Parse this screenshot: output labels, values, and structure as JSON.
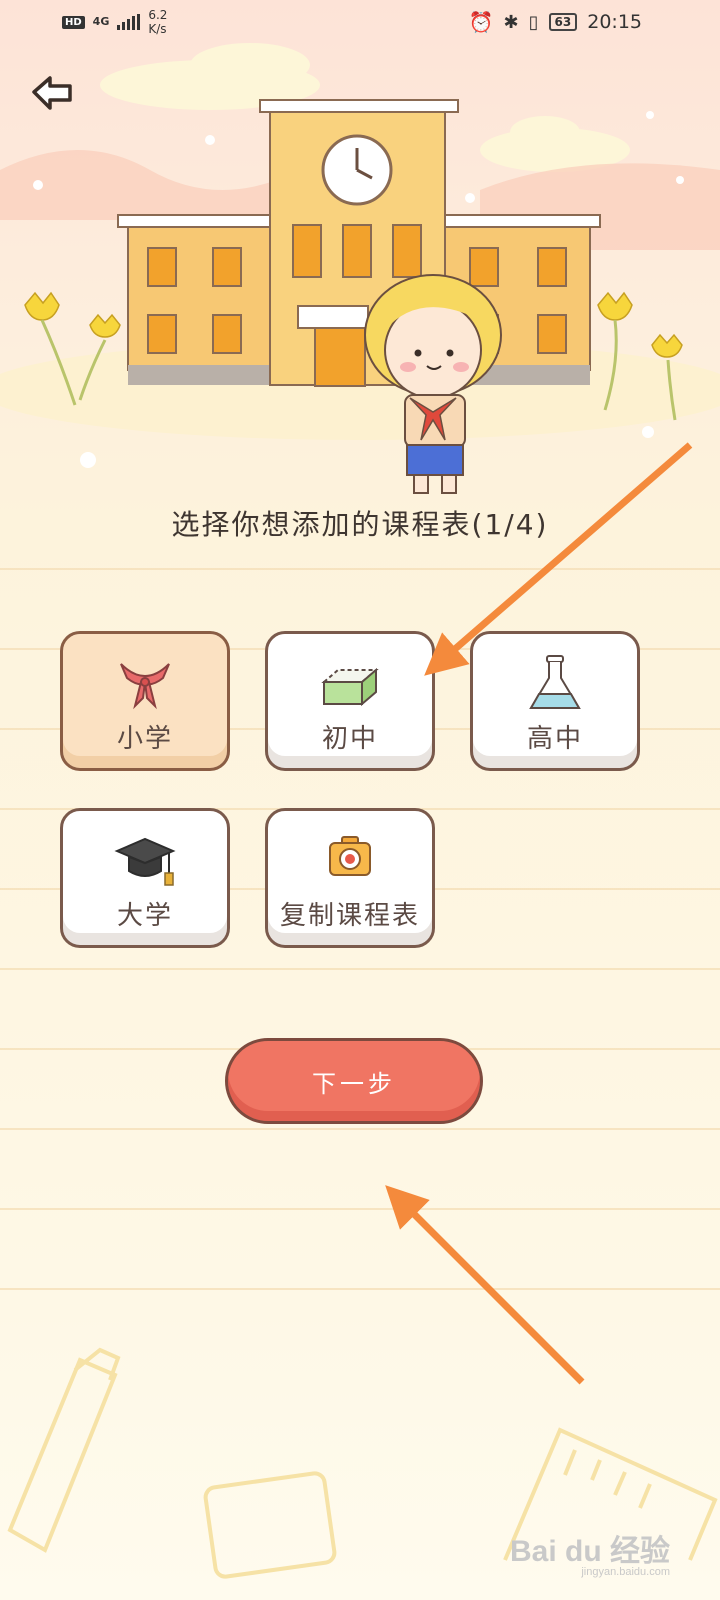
{
  "status_bar": {
    "hd": "HD",
    "network": "4G",
    "speed_value": "6.2",
    "speed_unit": "K/s",
    "battery": "63",
    "time": "20:15"
  },
  "page": {
    "title": "选择你想添加的课程表(1/4)"
  },
  "options": [
    {
      "label": "小学",
      "icon": "red-scarf-icon",
      "selected": true
    },
    {
      "label": "初中",
      "icon": "eraser-icon",
      "selected": false
    },
    {
      "label": "高中",
      "icon": "flask-icon",
      "selected": false
    },
    {
      "label": "大学",
      "icon": "graduation-cap-icon",
      "selected": false
    },
    {
      "label": "复制课程表",
      "icon": "camera-icon",
      "selected": false
    }
  ],
  "actions": {
    "next_label": "下一步"
  },
  "watermark": {
    "brand": "Bai du 经验",
    "url": "jingyan.baidu.com"
  },
  "colors": {
    "accent": "#f07563",
    "selected_bg": "#fbe1c2",
    "annotation_arrow": "#f48a3c"
  }
}
